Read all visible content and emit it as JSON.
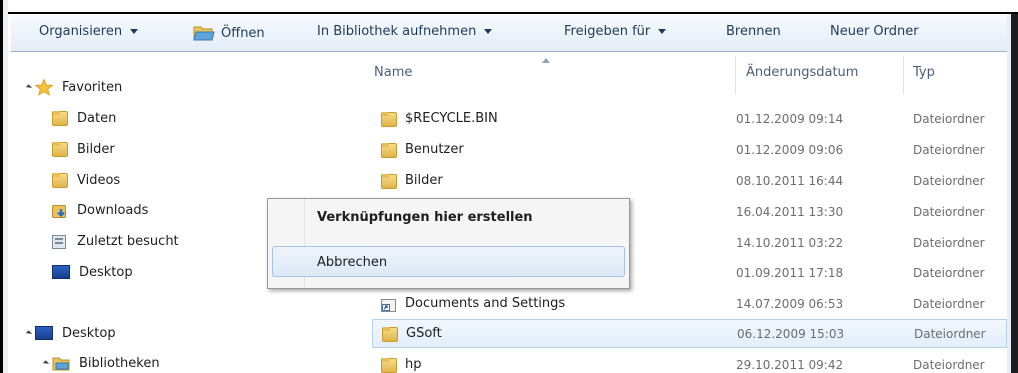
{
  "toolbar": {
    "organize": "Organisieren",
    "open": "Öffnen",
    "include_library": "In Bibliothek aufnehmen",
    "share_with": "Freigeben für",
    "burn": "Brennen",
    "new_folder": "Neuer Ordner"
  },
  "nav": {
    "favorites": "Favoriten",
    "items": [
      {
        "label": "Daten",
        "icon": "folder-icon"
      },
      {
        "label": "Bilder",
        "icon": "folder-icon"
      },
      {
        "label": "Videos",
        "icon": "folder-icon"
      },
      {
        "label": "Downloads",
        "icon": "downloads-folder-icon"
      },
      {
        "label": "Zuletzt besucht",
        "icon": "recent-places-icon"
      },
      {
        "label": "Desktop",
        "icon": "desktop-icon"
      }
    ],
    "desktop": "Desktop",
    "libraries": "Bibliotheken"
  },
  "columns": {
    "name": "Name",
    "date": "Änderungsdatum",
    "type": "Typ"
  },
  "files": [
    {
      "name": "$RECYCLE.BIN",
      "date": "01.12.2009 09:14",
      "type": "Dateiordner"
    },
    {
      "name": "Benutzer",
      "date": "01.12.2009 09:06",
      "type": "Dateiordner"
    },
    {
      "name": "Bilder",
      "date": "08.10.2011 16:44",
      "type": "Dateiordner"
    },
    {
      "name": "",
      "date": "16.04.2011 13:30",
      "type": "Dateiordner"
    },
    {
      "name": "",
      "date": "14.10.2011 03:22",
      "type": "Dateiordner"
    },
    {
      "name": "",
      "date": "01.09.2011 17:18",
      "type": "Dateiordner"
    },
    {
      "name": "Documents and Settings",
      "date": "14.07.2009 06:53",
      "type": "Dateiordner"
    },
    {
      "name": "GSoft",
      "date": "06.12.2009 15:03",
      "type": "Dateiordner"
    },
    {
      "name": "hp",
      "date": "29.10.2011 09:42",
      "type": "Dateiordner"
    }
  ],
  "context_menu": {
    "create_shortcuts": "Verknüpfungen hier erstellen",
    "cancel": "Abbrechen"
  },
  "colors": {
    "toolbar_text": "#1e395b",
    "selection_border": "#b6d2ee",
    "menu_hover_border": "#a7c1e3"
  }
}
